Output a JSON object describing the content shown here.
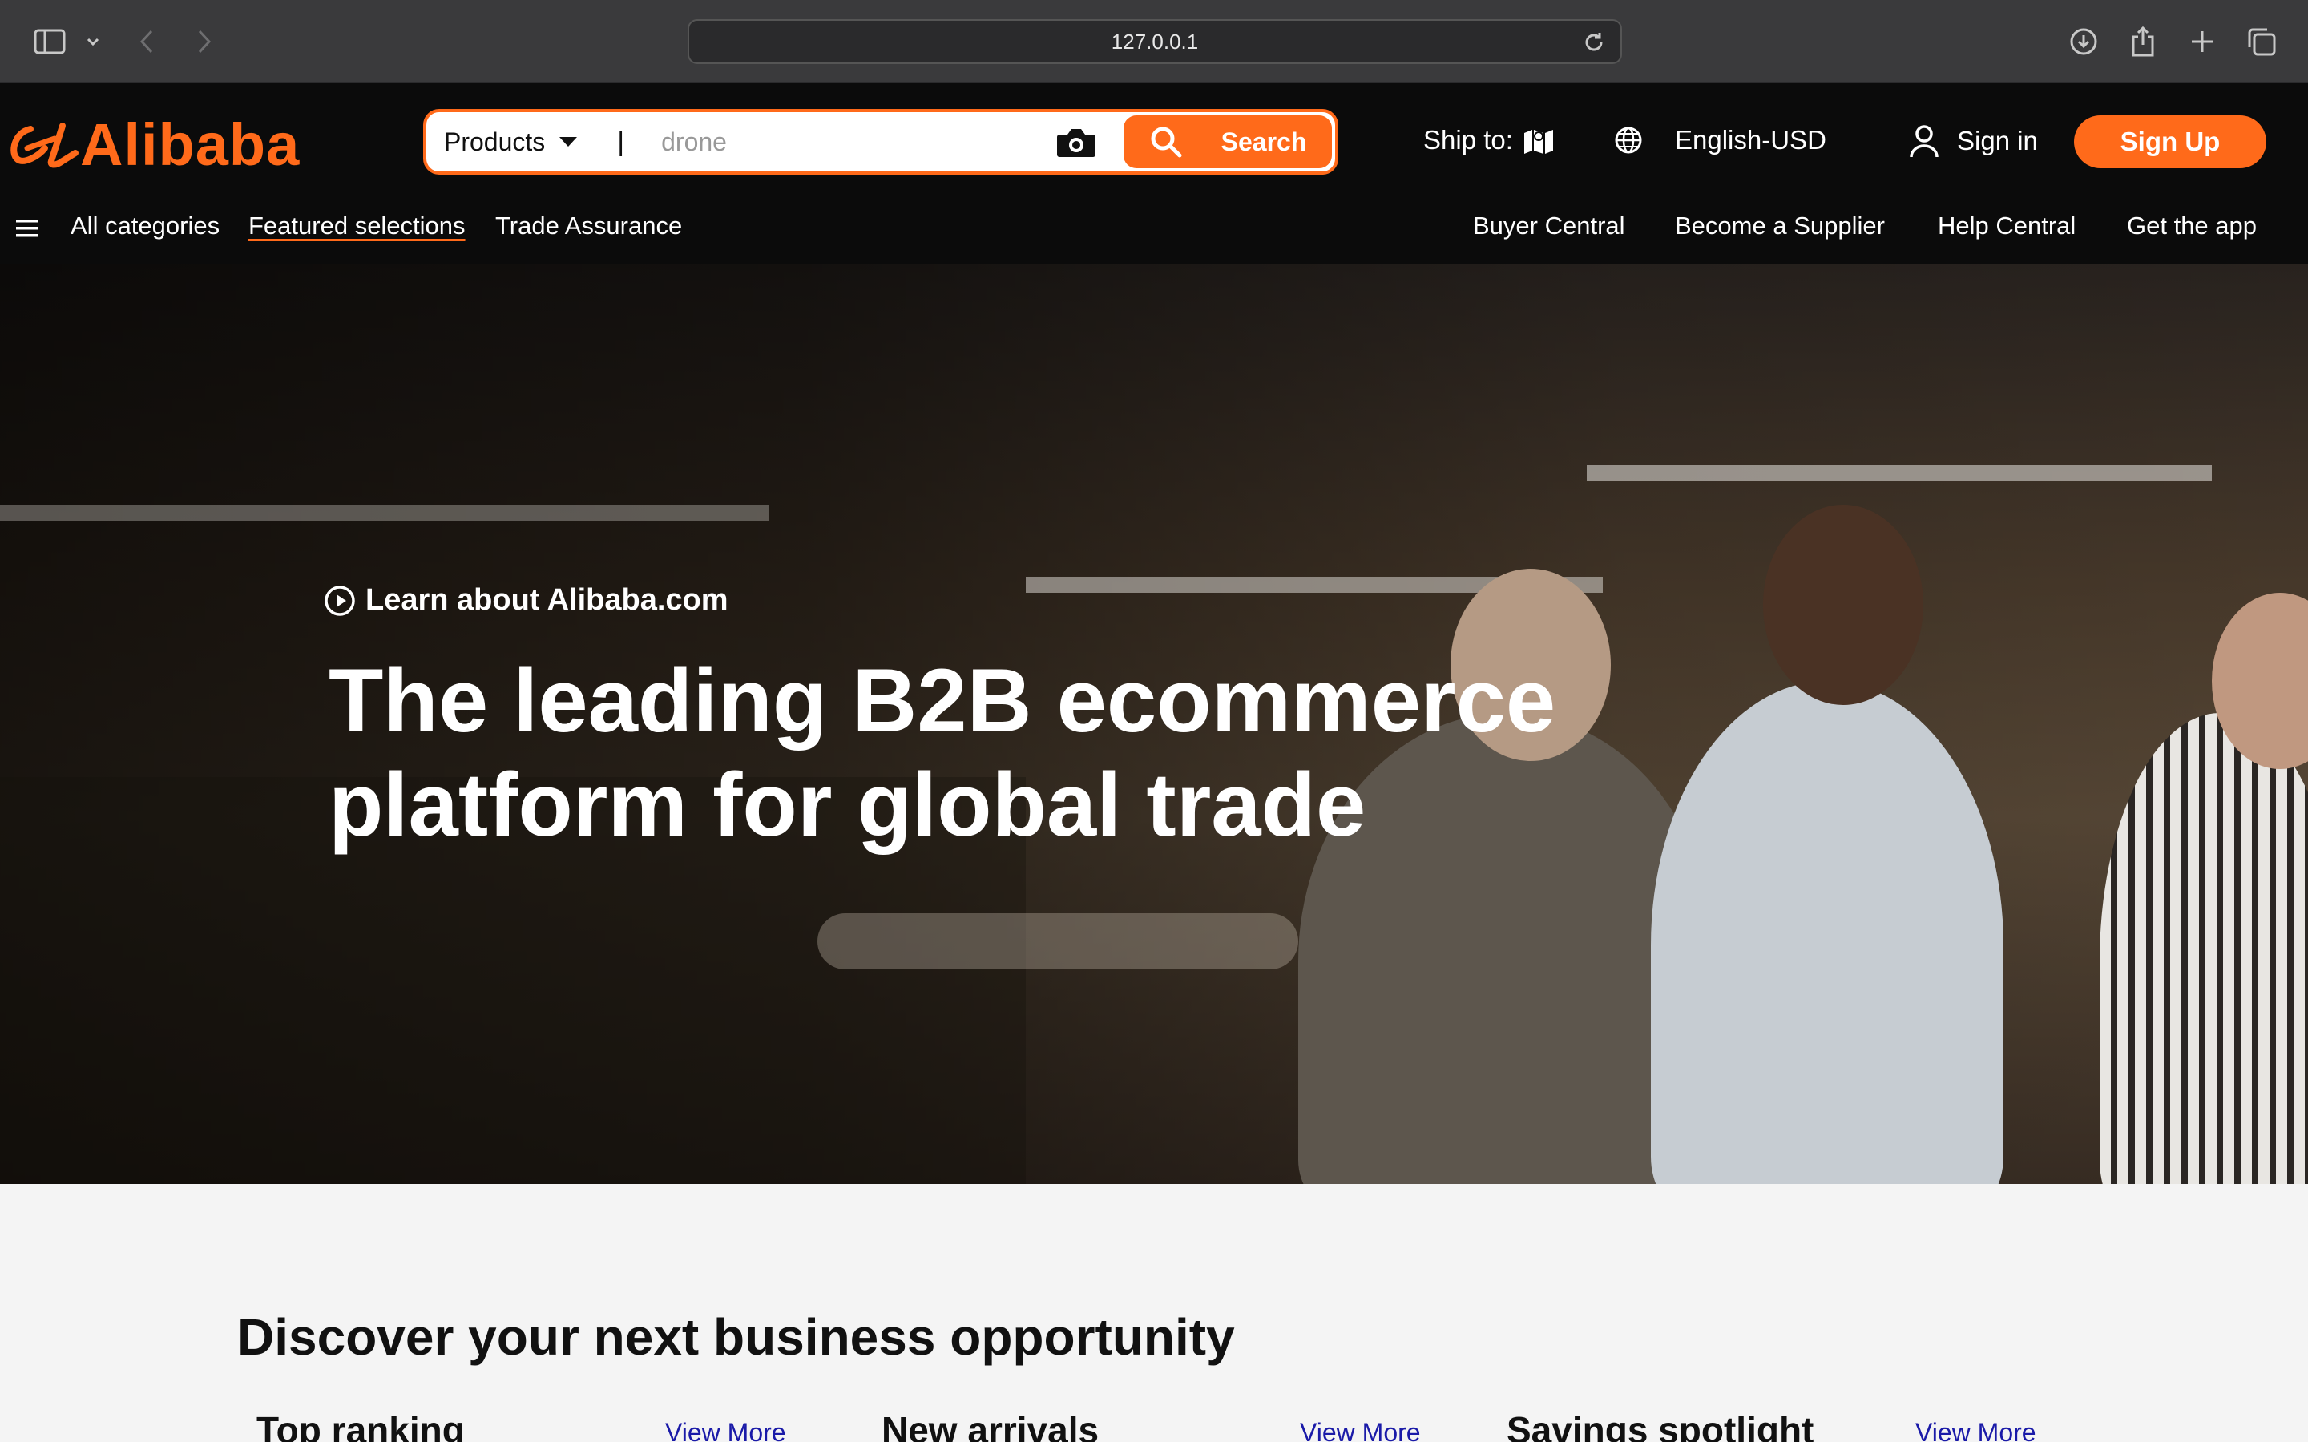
{
  "browser": {
    "url": "127.0.0.1"
  },
  "header": {
    "logo_text": "Alibaba",
    "search": {
      "category": "Products",
      "separator": "|",
      "placeholder": "drone",
      "button_label": "Search"
    },
    "ship_to_label": "Ship to:",
    "language_currency": "English-USD",
    "sign_in_label": "Sign in",
    "sign_up_label": "Sign Up"
  },
  "subnav": {
    "left": [
      "All categories",
      "Featured selections",
      "Trade Assurance"
    ],
    "right": [
      "Buyer Central",
      "Become a Supplier",
      "Help Central",
      "Get the app"
    ]
  },
  "hero": {
    "learn_label": "Learn about Alibaba.com",
    "headline_line1": "The leading B2B ecommerce",
    "headline_line2": "platform for global trade"
  },
  "discover": {
    "title": "Discover your next business opportunity",
    "columns": [
      {
        "title": "Top ranking",
        "link": "View More"
      },
      {
        "title": "New arrivals",
        "link": "View More"
      },
      {
        "title": "Savings spotlight",
        "link": "View More"
      }
    ]
  },
  "colors": {
    "brand_orange": "#ff6a1a",
    "header_bg": "#0b0b0b",
    "link_blue": "#1a1aa8"
  },
  "icons": [
    "sidebar-icon",
    "chevron-down-icon",
    "back-icon",
    "forward-icon",
    "reload-icon",
    "download-icon",
    "share-icon",
    "new-tab-icon",
    "tabs-overview-icon",
    "camera-icon",
    "search-icon",
    "map-icon",
    "globe-icon",
    "user-icon",
    "menu-icon",
    "play-circle-icon"
  ]
}
